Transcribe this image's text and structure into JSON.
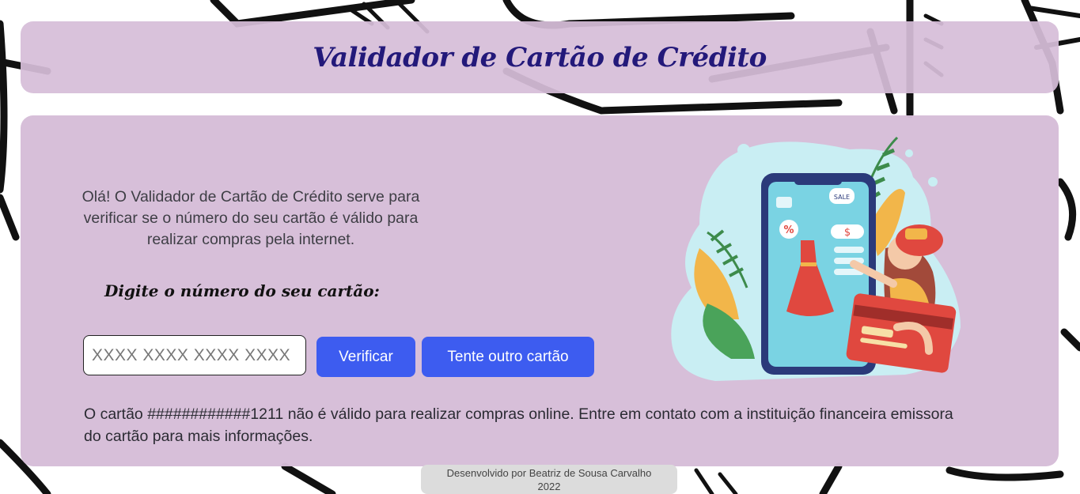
{
  "header": {
    "title": "Validador de Cartão de Crédito"
  },
  "main": {
    "intro": "Olá! O Validador de Cartão de Crédito serve para verificar se o número do seu cartão é válido para realizar compras pela internet.",
    "prompt": "Digite o número do seu cartão:",
    "card_input": {
      "placeholder": "XXXX XXXX XXXX XXXX",
      "value": ""
    },
    "verify_label": "Verificar",
    "retry_label": "Tente outro cartão",
    "result": "O cartão ############1211 não é válido para realizar compras online. Entre em contato com a instituição financeira emissora do cartão para mais informações.",
    "illustration": {
      "sale_tag": "SALE",
      "percent_badge": "%",
      "price_tag": "$"
    }
  },
  "footer": {
    "credit": "Desenvolvido por Beatriz de Sousa Carvalho",
    "year": "2022"
  },
  "colors": {
    "title": "#23197a",
    "panel": "#d6bdd8",
    "button": "#3d5cf0",
    "text": "#3e3e45"
  }
}
